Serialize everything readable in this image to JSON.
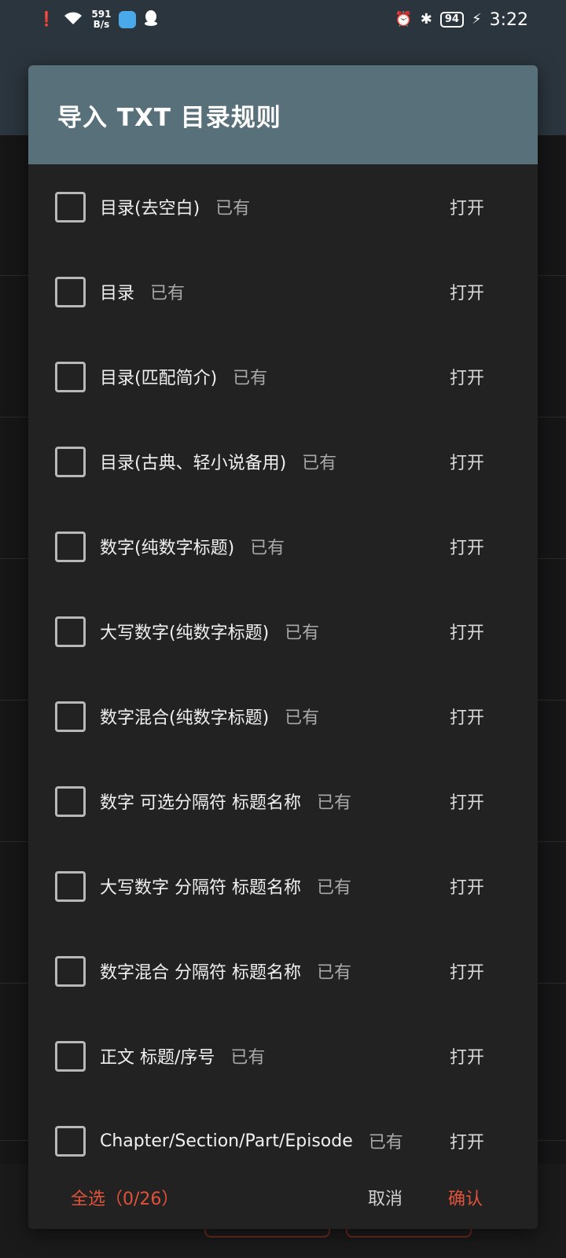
{
  "status_bar": {
    "net_speed_value": "591",
    "net_speed_unit": "B/s",
    "battery": "94",
    "time": "3:22"
  },
  "dialog": {
    "title": "导入 TXT 目录规则",
    "rules": [
      {
        "name": "目录(去空白)",
        "status": "已有",
        "action": "打开"
      },
      {
        "name": "目录",
        "status": "已有",
        "action": "打开"
      },
      {
        "name": "目录(匹配简介)",
        "status": "已有",
        "action": "打开"
      },
      {
        "name": "目录(古典、轻小说备用)",
        "status": "已有",
        "action": "打开"
      },
      {
        "name": "数字(纯数字标题)",
        "status": "已有",
        "action": "打开"
      },
      {
        "name": "大写数字(纯数字标题)",
        "status": "已有",
        "action": "打开"
      },
      {
        "name": "数字混合(纯数字标题)",
        "status": "已有",
        "action": "打开"
      },
      {
        "name": "数字 可选分隔符 标题名称",
        "status": "已有",
        "action": "打开"
      },
      {
        "name": "大写数字 分隔符 标题名称",
        "status": "已有",
        "action": "打开"
      },
      {
        "name": "数字混合 分隔符 标题名称",
        "status": "已有",
        "action": "打开"
      },
      {
        "name": "正文 标题/序号",
        "status": "已有",
        "action": "打开"
      },
      {
        "name": "Chapter/Section/Part/Episode",
        "status": "已有",
        "action": "打开"
      }
    ],
    "footer": {
      "select_all": "全选（0/26）",
      "cancel": "取消",
      "confirm": "确认"
    }
  },
  "colors": {
    "title_bar": "#587079",
    "accent": "#e0533a",
    "dialog_bg": "#222223"
  }
}
